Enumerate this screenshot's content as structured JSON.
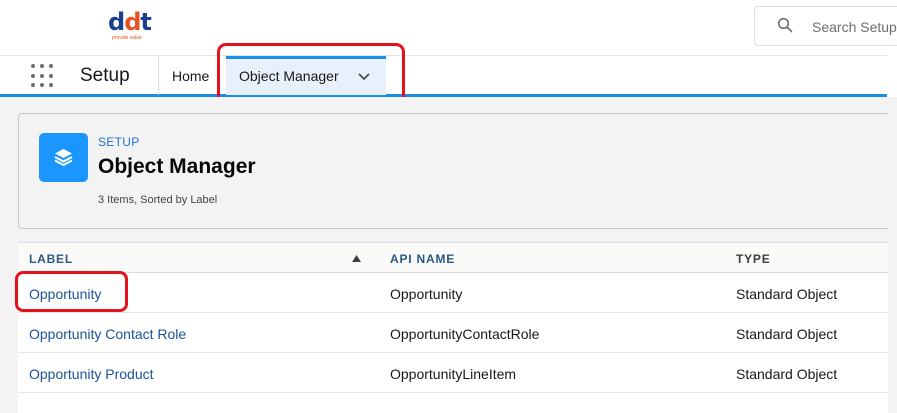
{
  "brand": {
    "logo_text": "ddt",
    "tagline": "provide value"
  },
  "search": {
    "placeholder": "Search Setup"
  },
  "nav": {
    "app_name": "Setup",
    "home_label": "Home",
    "active_tab_label": "Object Manager"
  },
  "header": {
    "subtitle": "SETUP",
    "title": "Object Manager",
    "meta": "3 Items, Sorted by Label"
  },
  "table": {
    "columns": [
      "LABEL",
      "API NAME",
      "TYPE"
    ],
    "rows": [
      {
        "label": "Opportunity",
        "api_name": "Opportunity",
        "type": "Standard Object"
      },
      {
        "label": "Opportunity Contact Role",
        "api_name": "OpportunityContactRole",
        "type": "Standard Object"
      },
      {
        "label": "Opportunity Product",
        "api_name": "OpportunityLineItem",
        "type": "Standard Object"
      }
    ]
  },
  "colors": {
    "accent": "#1b8fe8",
    "highlight": "#e3121c",
    "link": "#1b5297",
    "icon_bg": "#1b96ff"
  },
  "icons": {
    "search": "search-icon",
    "app_launcher": "waffle-icon",
    "tab_menu": "chevron-down-icon",
    "object_manager": "layers-icon",
    "sort": "sort-ascending-icon"
  }
}
